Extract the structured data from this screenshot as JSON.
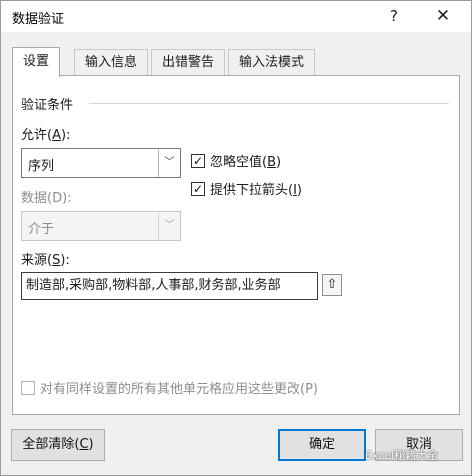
{
  "window": {
    "title": "数据验证",
    "help_label": "?",
    "close_label": "✕"
  },
  "tabs": [
    {
      "label": "设置",
      "active": true
    },
    {
      "label": "输入信息",
      "active": false
    },
    {
      "label": "出错警告",
      "active": false
    },
    {
      "label": "输入法模式",
      "active": false
    }
  ],
  "settings": {
    "group_title": "验证条件",
    "allow_label": "允许(",
    "allow_key": "A",
    "allow_suffix": "):",
    "allow_value": "序列",
    "data_label": "数据(D):",
    "data_value": "介于",
    "ignore_blank": {
      "label_prefix": "忽略空值(",
      "key": "B",
      "label_suffix": ")",
      "checked": true
    },
    "dropdown": {
      "label_prefix": "提供下拉箭头(",
      "key": "I",
      "label_suffix": ")",
      "checked": true
    },
    "source_label_prefix": "来源(",
    "source_key": "S",
    "source_label_suffix": "):",
    "source_value": "制造部,采购部,物料部,人事部,财务部,业务部",
    "apply_all": {
      "label": "对有同样设置的所有其他单元格应用这些更改(P)",
      "checked": false
    }
  },
  "buttons": {
    "clear_all_prefix": "全部清除(",
    "clear_all_key": "C",
    "clear_all_suffix": ")",
    "ok": "确定",
    "cancel": "取消"
  },
  "watermark": "Excel秘籍大全",
  "icons": {
    "check": "✓",
    "arrow_down": "﹀",
    "collapse": "⇧"
  }
}
